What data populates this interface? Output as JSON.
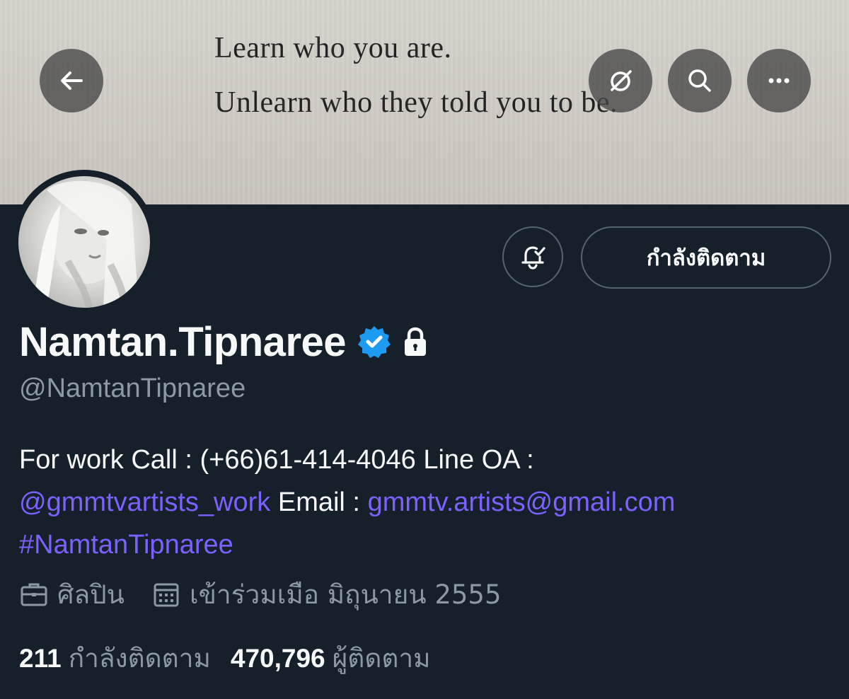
{
  "banner": {
    "line1": "Learn who you are.",
    "line2": "Unlearn who they told you to be."
  },
  "toolbar": {
    "back_icon": "arrow-left-icon",
    "grok_icon": "slash-circle-icon",
    "search_icon": "search-icon",
    "more_icon": "more-horizontal-icon"
  },
  "actions": {
    "notification_icon": "bell-check-icon",
    "follow_label": "กำลังติดตาม"
  },
  "profile": {
    "name": "Namtan.Tipnaree",
    "handle": "@NamtanTipnaree",
    "verified_color": "#1d9bf0",
    "link_color": "#7b61ff"
  },
  "bio": {
    "text1": "For work Call : (+66)61-414-4046 Line OA :",
    "link1": "@gmmtvartists_work",
    "text2": "Email :",
    "link2": "gmmtv.artists@gmail.com",
    "hashtag": "#NamtanTipnaree"
  },
  "meta": {
    "category": "ศิลปิน",
    "joined": "เข้าร่วมเมือ มิถุนายน 2555"
  },
  "stats": {
    "following_count": "211",
    "following_label": "กำลังติดตาม",
    "followers_count": "470,796",
    "followers_label": "ผู้ติดตาม"
  }
}
